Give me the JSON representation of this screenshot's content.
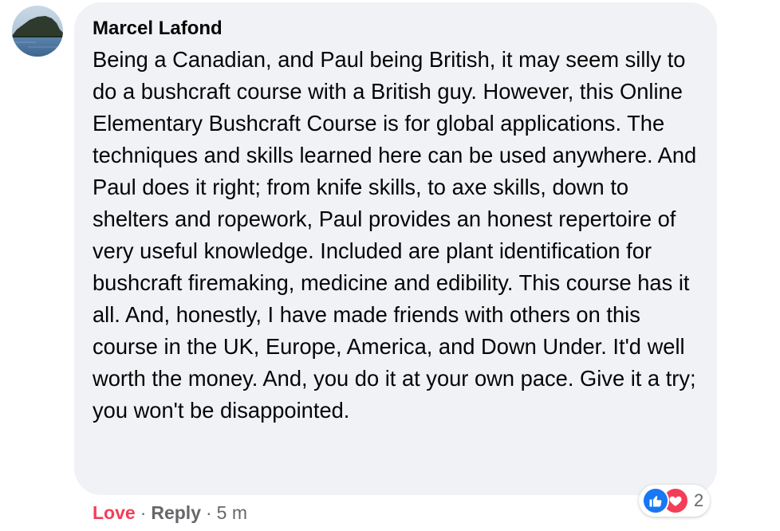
{
  "comment": {
    "author": "Marcel Lafond",
    "text": "Being a Canadian, and Paul being British, it may seem silly to do a bushcraft course with a British guy. However, this Online Elementary Bushcraft Course is for global applications. The techniques and skills learned here can be used anywhere. And Paul does it right; from knife skills, to axe skills, down to shelters and ropework, Paul provides an honest repertoire of very useful knowledge. Included are plant identification for bushcraft firemaking, medicine and edibility. This course has it all. And, honestly, I have made friends with others on this course in the UK, Europe, America, and Down Under. It'd well worth the money. And, you do it at your own pace. Give it a try; you won't be disappointed."
  },
  "reactions": {
    "icons": [
      "like-icon",
      "love-icon"
    ],
    "count": "2",
    "colors": {
      "like": "#1877f2",
      "love": "#f33e58"
    }
  },
  "actions": {
    "love_label": "Love",
    "reply_label": "Reply",
    "separator": "·",
    "timestamp": "5 m"
  },
  "colors": {
    "bubble": "#f0f2f5",
    "text": "#050505",
    "secondary": "#65676b",
    "love_accent": "#f33e58"
  }
}
